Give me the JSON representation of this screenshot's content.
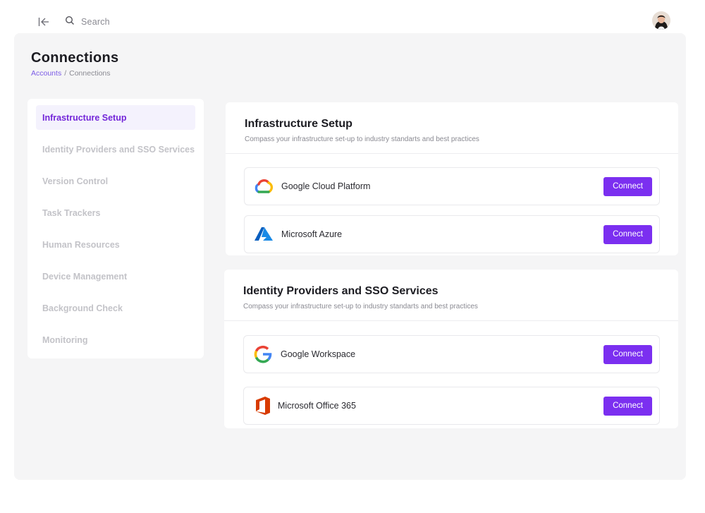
{
  "header": {
    "search_placeholder": "Search",
    "collapse_icon": "collapse-left-icon",
    "search_icon": "search-icon",
    "avatar_icon": "user-avatar"
  },
  "page": {
    "title": "Connections",
    "breadcrumb": {
      "parent": "Accounts",
      "separator": "/",
      "current": "Connections"
    }
  },
  "sidebar": {
    "items": [
      {
        "label": "Infrastructure Setup",
        "active": true
      },
      {
        "label": "Identity Providers and SSO Services",
        "active": false
      },
      {
        "label": "Version Control",
        "active": false
      },
      {
        "label": "Task Trackers",
        "active": false
      },
      {
        "label": "Human Resources",
        "active": false
      },
      {
        "label": "Device Management",
        "active": false
      },
      {
        "label": "Background Check",
        "active": false
      },
      {
        "label": "Monitoring",
        "active": false
      }
    ]
  },
  "sections": [
    {
      "title": "Infrastructure Setup",
      "subtitle": "Compass your infrastructure set-up to industry standarts and best practices",
      "connections": [
        {
          "name": "Google Cloud Platform",
          "icon": "google-cloud-icon",
          "button": "Connect"
        },
        {
          "name": "Microsoft Azure",
          "icon": "azure-icon",
          "button": "Connect"
        }
      ]
    },
    {
      "title": "Identity Providers and SSO Services",
      "subtitle": "Compass your infrastructure set-up to industry standarts and best practices",
      "connections": [
        {
          "name": "Google Workspace",
          "icon": "google-icon",
          "button": "Connect"
        },
        {
          "name": "Microsoft Office 365",
          "icon": "office-365-icon",
          "button": "Connect"
        }
      ]
    }
  ],
  "colors": {
    "accent": "#7b2ff0",
    "active_nav_text": "#7326d9",
    "active_nav_bg": "#f4f2fd",
    "panel_bg": "#f5f5f6",
    "muted_text": "#c3c3c8"
  }
}
